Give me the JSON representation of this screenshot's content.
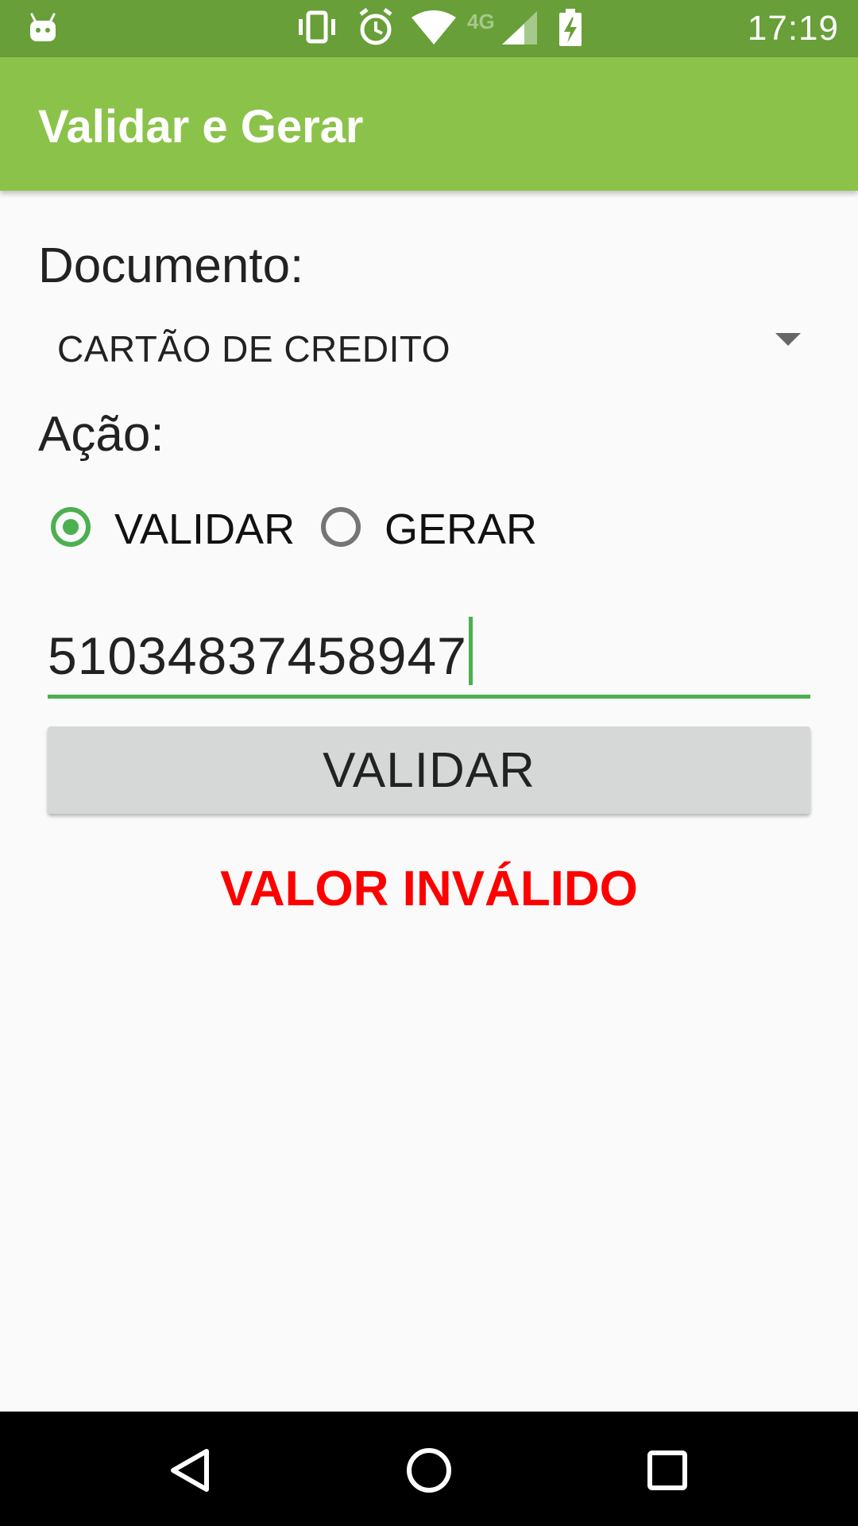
{
  "status_bar": {
    "time": "17:19",
    "network": "4G",
    "icons": [
      "android-icon",
      "vibrate-icon",
      "alarm-icon",
      "wifi-icon",
      "signal-icon",
      "battery-charging-icon"
    ]
  },
  "app_bar": {
    "title": "Validar e Gerar"
  },
  "form": {
    "document_label": "Documento:",
    "document_selected": "CARTÃO DE CREDITO",
    "action_label": "Ação:",
    "options": [
      {
        "label": "VALIDAR",
        "checked": true
      },
      {
        "label": "GERAR",
        "checked": false
      }
    ],
    "input_value": "51034837458947",
    "button_label": "VALIDAR",
    "result_text": "VALOR INVÁLIDO"
  },
  "colors": {
    "status_bar": "#689f38",
    "app_bar": "#8bc34a",
    "accent": "#4caf50",
    "error": "#ff0000"
  },
  "nav_bar": {
    "icons": [
      "back-icon",
      "home-icon",
      "recents-icon"
    ]
  }
}
